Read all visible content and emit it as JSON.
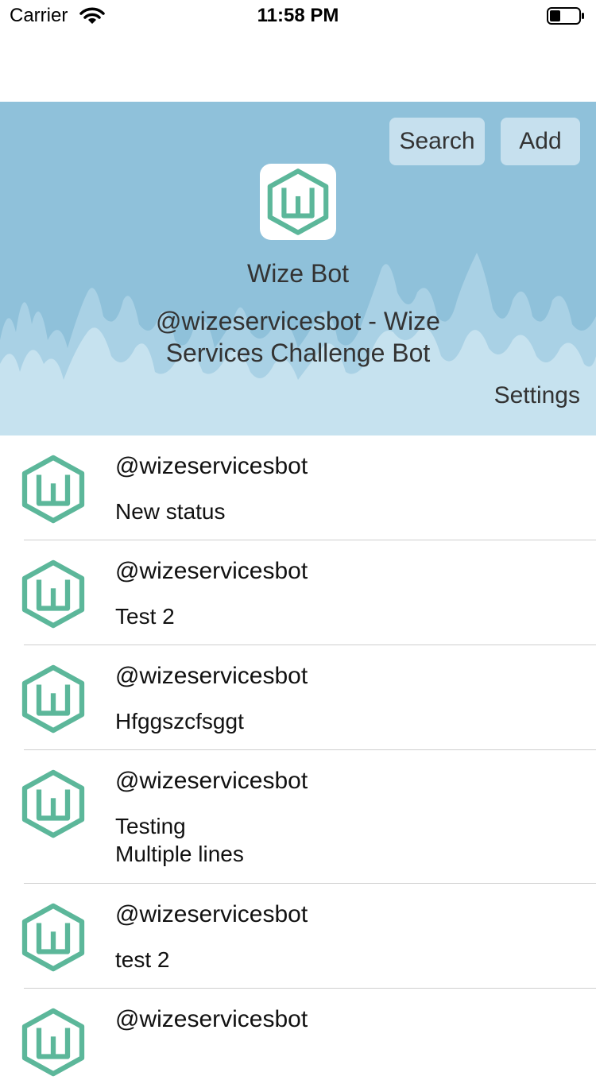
{
  "status_bar": {
    "carrier": "Carrier",
    "time": "11:58 PM"
  },
  "header": {
    "search_label": "Search",
    "add_label": "Add",
    "bot_name": "Wize Bot",
    "bot_description": "@wizeservicesbot - Wize Services Challenge Bot",
    "settings_label": "Settings",
    "background_color": "#8fc1da",
    "logo_color": "#5cb79a"
  },
  "statuses": [
    {
      "handle": "@wizeservicesbot",
      "text": "New status"
    },
    {
      "handle": "@wizeservicesbot",
      "text": "Test 2"
    },
    {
      "handle": "@wizeservicesbot",
      "text": "Hfggszcfsggt"
    },
    {
      "handle": "@wizeservicesbot",
      "text": "Testing\nMultiple lines"
    },
    {
      "handle": "@wizeservicesbot",
      "text": "test 2"
    },
    {
      "handle": "@wizeservicesbot",
      "text": ""
    }
  ]
}
